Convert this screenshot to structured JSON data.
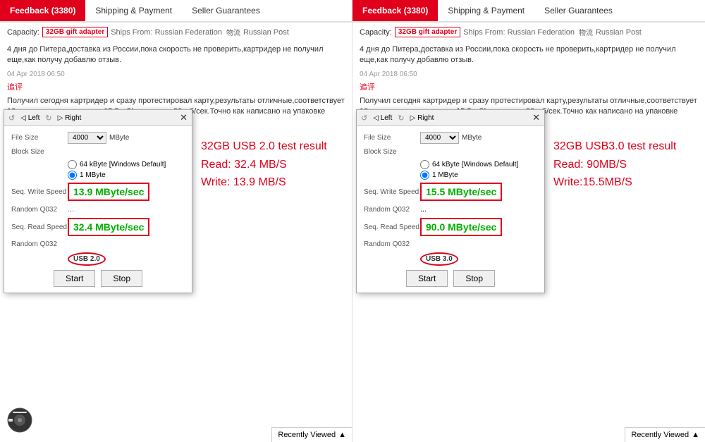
{
  "panels": [
    {
      "id": "left",
      "tabs": [
        {
          "id": "feedback",
          "label": "Feedback (3380)",
          "active": true
        },
        {
          "id": "shipping",
          "label": "Shipping & Payment",
          "active": false
        },
        {
          "id": "guarantees",
          "label": "Seller Guarantees",
          "active": false
        }
      ],
      "capacity": "32GB gift adapter",
      "ships_from": "Ships From: Russian Federation",
      "shipping_icon": "物流",
      "shipping_carrier": "Russian Post",
      "review_text": "4 дня до Питера,доставка из России,пока скорость не проверить,картридер не получил еще,как получу добавлю отзыв.",
      "review_date": "04 Apr 2018 06:50",
      "addon_label": "追评",
      "addon_text": "Получил сегодня картридер и сразу протестировал карту,результаты отличные,соответствует 10 классу,скорость записи 15,5 мб/сек,чтения 90 мб/сек.Точно как написано на упаковке карточки.",
      "benchmark": {
        "title_left": "◁ Left",
        "title_right": "▷ Right",
        "file_size_label": "File Size",
        "file_size_value": "4000",
        "file_size_unit": "MByte",
        "block_size_label": "Block Size",
        "block_size_option1": "64 kByte [Windows Default]",
        "block_size_option2": "1 MByte",
        "seq_write_label": "Seq. Write Speed",
        "seq_write_value": "13.9 MByte/sec",
        "random_label1": "Random Q032",
        "ellipsis": "...",
        "seq_read_label": "Seq. Read Speed",
        "seq_read_value": "32.4 MByte/sec",
        "random_label2": "Random Q032",
        "usb_badge": "USB 2.0",
        "start_btn": "Start",
        "stop_btn": "Stop"
      },
      "note_line1": "32GB USB 2.0 test result",
      "note_line2": "Read: 32.4 MB/S",
      "note_line3": "Write: 13.9 MB/S"
    },
    {
      "id": "right",
      "tabs": [
        {
          "id": "feedback",
          "label": "Feedback (3380)",
          "active": true
        },
        {
          "id": "shipping",
          "label": "Shipping & Payment",
          "active": false
        },
        {
          "id": "guarantees",
          "label": "Seller Guarantees",
          "active": false
        }
      ],
      "capacity": "32GB gift adapter",
      "ships_from": "Ships From: Russian Federation",
      "shipping_icon": "物流",
      "shipping_carrier": "Russian Post",
      "review_text": "4 дня до Питера,доставка из России,пока скорость не проверить,картридер не получил еще,как получу добавлю отзыв.",
      "review_date": "04 Apr 2018 06:50",
      "addon_label": "追评",
      "addon_text": "Получил сегодня картридер и сразу протестировал карту,результаты отличные,соответствует 10 классу,скорость записи 15,5 мб/сек,чтения 90 мб/сек.Точно как написано на упаковке карточки.",
      "benchmark": {
        "title_left": "◁ Left",
        "title_right": "▷ Right",
        "file_size_label": "File Size",
        "file_size_value": "4000",
        "file_size_unit": "MByte",
        "block_size_label": "Block Size",
        "block_size_option1": "64 kByte [Windows Default]",
        "block_size_option2": "1 MByte",
        "seq_write_label": "Seq. Write Speed",
        "seq_write_value": "15.5 MByte/sec",
        "random_label1": "Random Q032",
        "ellipsis": "...",
        "seq_read_label": "Seq. Read Speed",
        "seq_read_value": "90.0 MByte/sec",
        "random_label2": "Random Q032",
        "usb_badge": "USB 3.0",
        "start_btn": "Start",
        "stop_btn": "Stop"
      },
      "note_line1": "32GB USB3.0 test result",
      "note_line2": "Read: 90MB/S",
      "note_line3": "Write:15.5MB/S"
    }
  ],
  "recently_viewed": "Recently Viewed",
  "chevron_icon": "▲"
}
